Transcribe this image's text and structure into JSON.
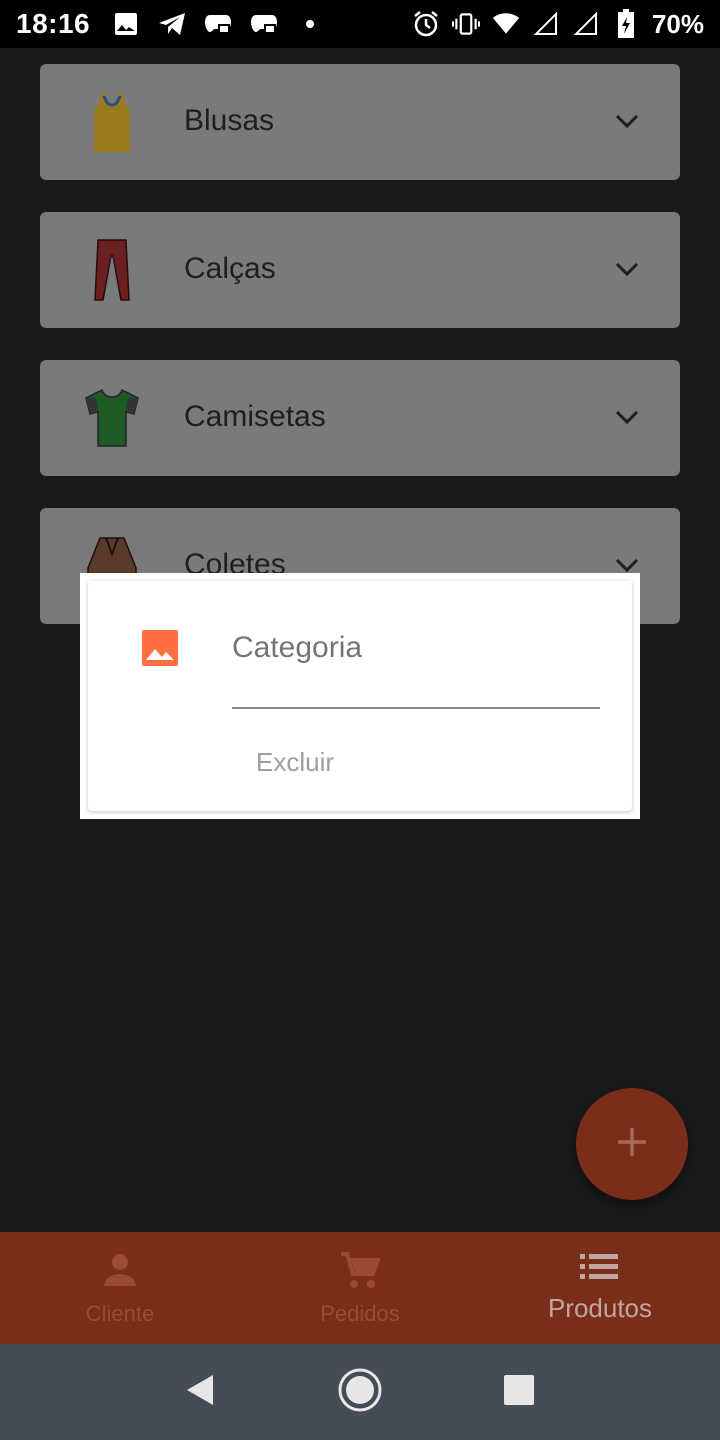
{
  "status_bar": {
    "time": "18:16",
    "battery_text": "70%",
    "left_icons": [
      "image-icon",
      "telegram-icon",
      "game-controller-icon",
      "game-controller-icon",
      "dot-icon"
    ],
    "right_icons": [
      "alarm-icon",
      "vibrate-icon",
      "wifi-icon",
      "signal-icon",
      "signal-icon",
      "battery-charging-icon"
    ]
  },
  "categories": [
    {
      "label": "Blusas",
      "icon": "tank-top-icon"
    },
    {
      "label": "Calças",
      "icon": "pants-icon"
    },
    {
      "label": "Camisetas",
      "icon": "tshirt-icon"
    },
    {
      "label": "Coletes",
      "icon": "vest-icon"
    }
  ],
  "dialog": {
    "field_value": "Categoria",
    "delete_label": "Excluir",
    "icon": "image-icon",
    "icon_color": "#ff6e40"
  },
  "fab": {
    "label": "+"
  },
  "bottom_nav": {
    "items": [
      {
        "label": "Cliente",
        "icon": "person-icon"
      },
      {
        "label": "Pedidos",
        "icon": "cart-icon"
      },
      {
        "label": "Produtos",
        "icon": "list-icon"
      }
    ],
    "active_index": 2
  },
  "colors": {
    "accent": "#7a2e1a",
    "background": "#1a1a1a",
    "card": "#7a7a7a"
  }
}
